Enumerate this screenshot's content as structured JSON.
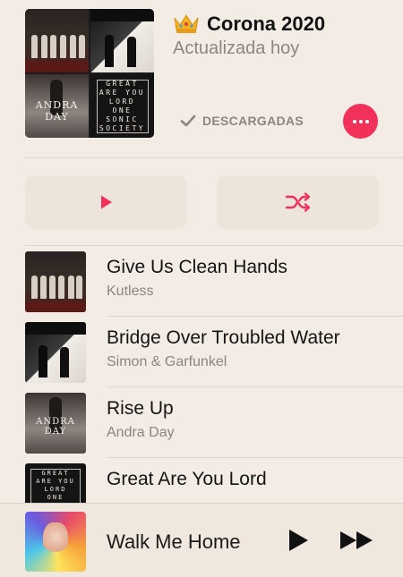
{
  "playlist": {
    "title": "Corona 2020",
    "subtitle": "Actualizada hoy",
    "downloads_label": "DESCARGADAS",
    "title_icon": "crown-icon",
    "accent": "#f2315a"
  },
  "artwork": {
    "great_are_you_lord_lines": [
      "GREAT",
      "ARE YOU",
      "LORD",
      "ONE",
      "SONIC",
      "SOCIETY"
    ],
    "andra_day_word": "ANDRA DAY"
  },
  "controls": {
    "play_icon": "play-icon",
    "shuffle_icon": "shuffle-icon"
  },
  "tracks": [
    {
      "title": "Give Us Clean Hands",
      "artist": "Kutless"
    },
    {
      "title": "Bridge Over Troubled Water",
      "artist": "Simon & Garfunkel"
    },
    {
      "title": "Rise Up",
      "artist": "Andra Day"
    },
    {
      "title": "Great Are You Lord",
      "artist": ""
    }
  ],
  "now_playing": {
    "title": "Walk Me Home",
    "play_icon": "play-icon",
    "next_icon": "fast-forward-icon"
  }
}
